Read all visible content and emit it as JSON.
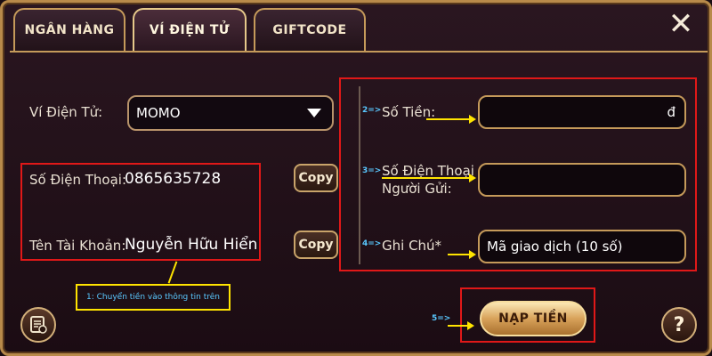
{
  "tabs": [
    {
      "label": "NGÂN HÀNG",
      "active": false
    },
    {
      "label": "VÍ ĐIỆN TỬ",
      "active": true
    },
    {
      "label": "GIFTCODE",
      "active": false
    }
  ],
  "close": {
    "icon": "close-icon",
    "glyph": "✕"
  },
  "wallet": {
    "label": "Ví Điện Tử:",
    "selected": "MOMO"
  },
  "recipient": {
    "phone_label": "Số Điện Thoại:",
    "phone_value": "0865635728",
    "name_label": "Tên Tài Khoản:",
    "name_value": "Nguyễn Hữu Hiển",
    "copy_label": "Copy"
  },
  "form": {
    "amount_label": "Số Tiền:",
    "amount_suffix": "đ",
    "sender_phone_label_1": "Số Điện Thoại",
    "sender_phone_label_2": "Người Gửi:",
    "note_label": "Ghi Chú*",
    "note_value": "Mã giao dịch (10 số)"
  },
  "steps": {
    "s1": "1: Chuyển tiền vào thông tin trên",
    "s2": "2=>",
    "s3": "3=>",
    "s4": "4=>",
    "s5": "5=>"
  },
  "submit_label": "NẠP TIỀN",
  "help_glyph": "?",
  "colors": {
    "accent_gold": "#c59a5a",
    "highlight_red": "#e01818",
    "annotation_yellow": "#ffe400",
    "annotation_blue": "#59c8ff"
  }
}
